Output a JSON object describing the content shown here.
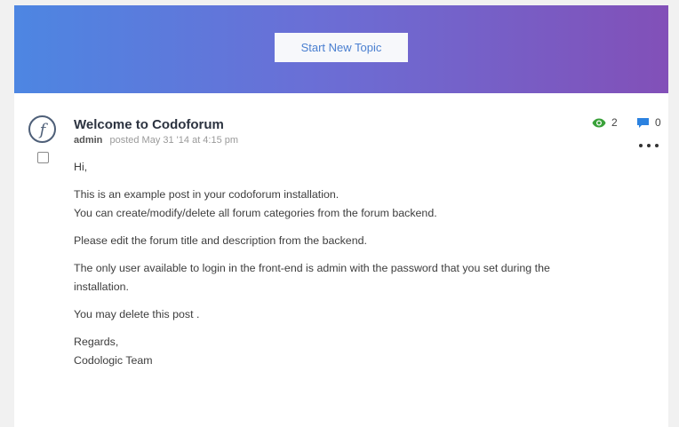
{
  "banner": {
    "start_topic_label": "Start New Topic"
  },
  "post": {
    "title": "Welcome to Codoforum",
    "author": "admin",
    "posted_text": "posted May 31 '14 at 4:15 pm",
    "views": "2",
    "replies": "0",
    "paragraphs": [
      "Hi,",
      "This is an example post in your codoforum installation.",
      "You can create/modify/delete all forum categories from the forum backend.",
      "Please edit the forum title and description from the backend.",
      "The only user available to login in the front-end is admin with the password that you set during the installation.",
      "You may delete this post .",
      "Regards,",
      "Codologic Team"
    ]
  },
  "colors": {
    "views_icon": "#3aa13a",
    "replies_icon": "#2c82e0",
    "banner_start": "#4d86e2",
    "banner_end": "#8250b8"
  },
  "icons": {
    "avatar": "codoforum-f-logo",
    "views": "eye-icon",
    "replies": "comment-icon",
    "more": "more-options-icon"
  }
}
